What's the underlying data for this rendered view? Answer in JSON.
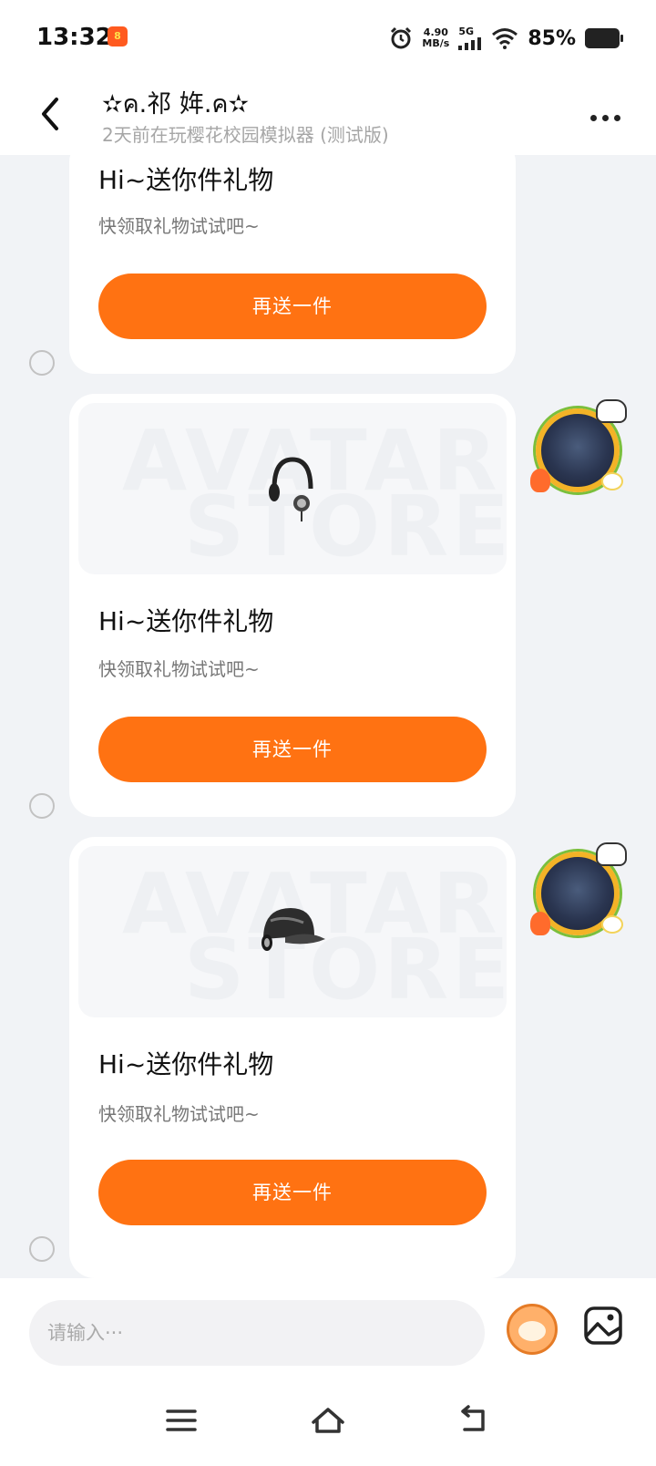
{
  "status_bar": {
    "time": "13:32",
    "app_badge": "8",
    "net_speed_value": "4.90",
    "net_speed_unit": "MB/s",
    "network": "5G",
    "battery_percent": "85%",
    "battery_level": 0.85,
    "icons": [
      "alarm-icon",
      "signal-icon",
      "wifi-icon",
      "battery-icon"
    ]
  },
  "header": {
    "title": "✫ค.祁 姩.ค✫",
    "subtitle": "2天前在玩樱花校园模拟器 (测试版)",
    "back_icon": "chevron-left-icon",
    "more_icon": "more-dots-icon"
  },
  "messages": [
    {
      "title": "Hi~送你件礼物",
      "description": "快领取礼物试试吧~",
      "button_label": "再送一件",
      "item": "",
      "watermark_line1": "",
      "watermark_line2": ""
    },
    {
      "title": "Hi~送你件礼物",
      "description": "快领取礼物试试吧~",
      "button_label": "再送一件",
      "item": "headphones-icon",
      "watermark_line1": "AVATAR",
      "watermark_line2": "STORE"
    },
    {
      "title": "Hi~送你件礼物",
      "description": "快领取礼物试试吧~",
      "button_label": "再送一件",
      "item": "cap-icon",
      "watermark_line1": "AVATAR",
      "watermark_line2": "STORE"
    }
  ],
  "input": {
    "placeholder": "请输入···",
    "emoji_icon": "mascot-emoji-icon",
    "image_icon": "image-icon"
  },
  "nav": {
    "icons": [
      "menu-icon",
      "home-icon",
      "back-icon"
    ]
  },
  "colors": {
    "accent": "#ff7212",
    "background": "#f1f3f6",
    "card": "#ffffff"
  }
}
